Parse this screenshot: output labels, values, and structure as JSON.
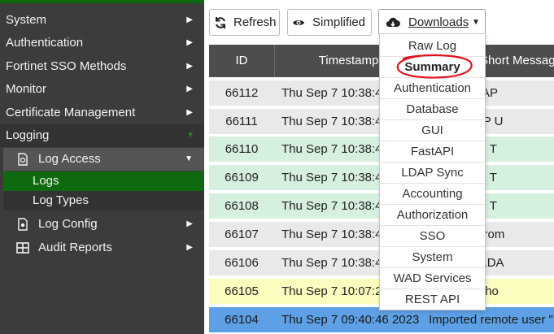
{
  "sidebar": {
    "items": [
      {
        "label": "System"
      },
      {
        "label": "Authentication"
      },
      {
        "label": "Fortinet SSO Methods"
      },
      {
        "label": "Monitor"
      },
      {
        "label": "Certificate Management"
      },
      {
        "label": "Logging"
      }
    ],
    "logging": {
      "log_access": "Log Access",
      "logs": "Logs",
      "log_types": "Log Types",
      "log_config": "Log Config",
      "audit_reports": "Audit Reports"
    }
  },
  "toolbar": {
    "refresh_label": "Refresh",
    "simplified_label": "Simplified",
    "downloads_label": "Downloads"
  },
  "downloads_menu": {
    "items": [
      "Raw Log",
      "Summary",
      "Authentication",
      "Database",
      "GUI",
      "FastAPI",
      "LDAP Sync",
      "Accounting",
      "Authorization",
      "SSO",
      "System",
      "WAD Services",
      "REST API"
    ],
    "highlighted": "Summary"
  },
  "table": {
    "columns": [
      "ID",
      "Timestamp",
      "Short Message"
    ],
    "rows": [
      {
        "id": "66112",
        "timestamp": "Thu Sep 7 10:38:4",
        "message": "emote LDAP",
        "status": "info"
      },
      {
        "id": "66111",
        "timestamp": "Thu Sep 7 10:38:4",
        "message": "mote LDAP U",
        "status": "info"
      },
      {
        "id": "66110",
        "timestamp": "Thu Sep 7 10:38:4",
        "message": "update the T",
        "status": "success"
      },
      {
        "id": "66109",
        "timestamp": "Thu Sep 7 10:38:4",
        "message": "update the T",
        "status": "success"
      },
      {
        "id": "66108",
        "timestamp": "Thu Sep 7 10:38:4",
        "message": "update the T",
        "status": "success"
      },
      {
        "id": "66107",
        "timestamp": "Thu Sep 7 10:38:4",
        "message": "4 user(s) from",
        "status": "info"
      },
      {
        "id": "66106",
        "timestamp": "Thu Sep 7 10:38:4",
        "message": "g remote LDA",
        "status": "info"
      },
      {
        "id": "66105",
        "timestamp": "Thu Sep 7 10:07:2",
        "message": "ld not find ho",
        "status": "warning"
      },
      {
        "id": "66104",
        "timestamp": "Thu Sep 7 09:40:46 2023",
        "message": "Imported remote user \"",
        "status": "selected"
      }
    ]
  },
  "colors": {
    "sidebar_bg": "#3c3c3c",
    "accent_green": "#0f6a0f",
    "row_info": "#e9e9e9",
    "row_success": "#d6f0df",
    "row_warning": "#fdfcbf",
    "row_selected": "#5ea0e5",
    "annotation_red": "#e0141e"
  }
}
